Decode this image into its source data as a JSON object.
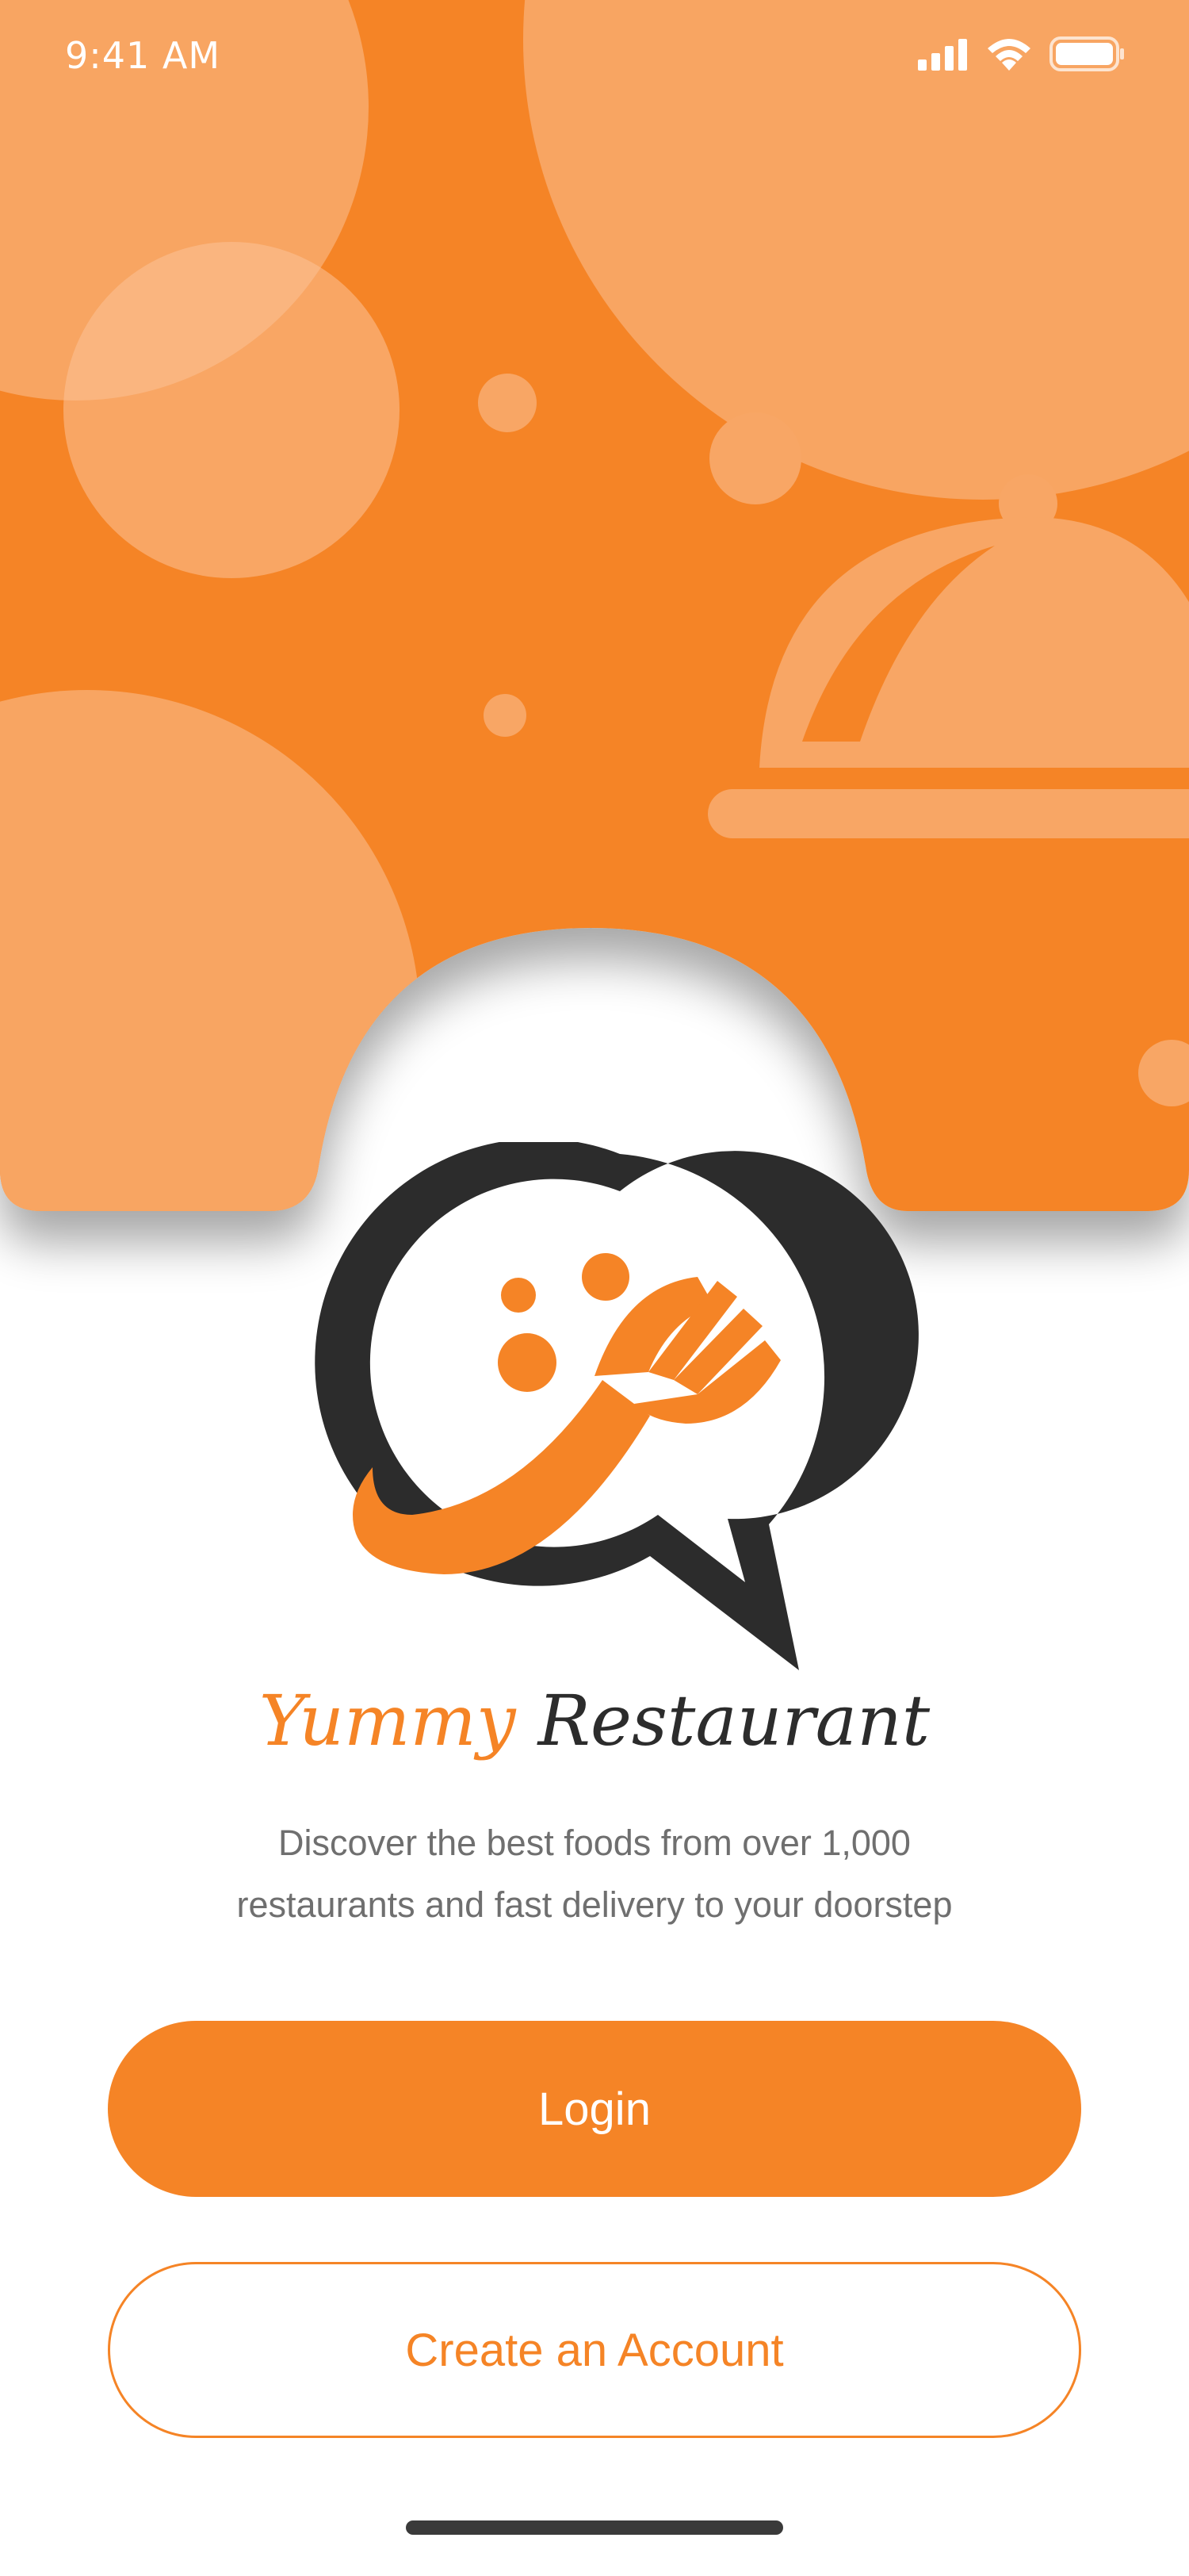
{
  "status_bar": {
    "time": "9:41 AM"
  },
  "brand": {
    "name_first": "Yummy",
    "name_second": "Restaurant"
  },
  "tagline": {
    "line1": "Discover the best foods from over 1,000",
    "line2": "restaurants and fast delivery to your doorstep"
  },
  "actions": {
    "login_label": "Login",
    "create_account_label": "Create an Account"
  },
  "colors": {
    "accent": "#f58426",
    "accent_light": "#f8a665",
    "dark": "#2c2c2c",
    "text_muted": "#6f6f6f"
  },
  "icons": {
    "status": [
      "signal-icon",
      "wifi-icon",
      "battery-icon"
    ],
    "hero_decoration": "cloche-icon",
    "logo": "chat-bubble-fork-icon"
  }
}
